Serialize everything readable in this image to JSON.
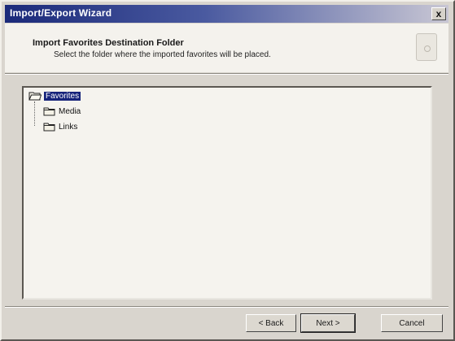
{
  "window": {
    "title": "Import/Export Wizard",
    "close_label": "x"
  },
  "header": {
    "title": "Import Favorites Destination Folder",
    "subtitle": "Select the folder where the imported favorites will be placed."
  },
  "tree": {
    "root": {
      "label": "Favorites",
      "icon": "folder-open-icon",
      "selected": true
    },
    "children": [
      {
        "label": "Media",
        "icon": "folder-icon"
      },
      {
        "label": "Links",
        "icon": "folder-icon"
      }
    ]
  },
  "buttons": {
    "back": "< Back",
    "next": "Next >",
    "cancel": "Cancel"
  },
  "colors": {
    "title_bar": "#1b2a7a",
    "selection": "#16237a"
  }
}
